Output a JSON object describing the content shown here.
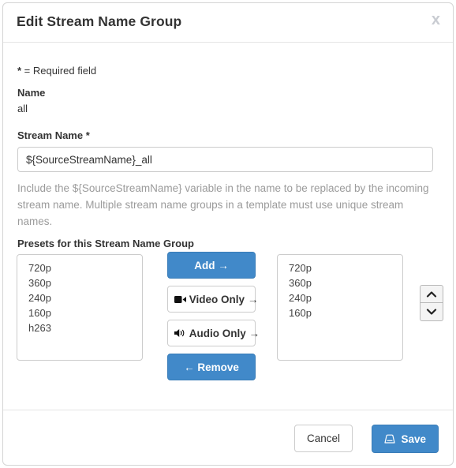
{
  "modal": {
    "title": "Edit Stream Name Group",
    "close_label": "x"
  },
  "form": {
    "required_note_star": "*",
    "required_note_text": " = Required field",
    "name_label": "Name",
    "name_value": "all",
    "stream_name_label": "Stream Name *",
    "stream_name_value": "${SourceStreamName}_all",
    "stream_name_placeholder": "${SourceStreamName}",
    "help_text": "Include the ${SourceStreamName} variable in the name to be replaced by the incoming stream name. Multiple stream name groups in a template must use unique stream names."
  },
  "presets": {
    "section_label": "Presets for this Stream Name Group",
    "available": [
      "720p",
      "360p",
      "240p",
      "160p",
      "h263"
    ],
    "selected": [
      "720p",
      "360p",
      "240p",
      "160p"
    ],
    "buttons": {
      "add": "Add",
      "add_arrow": "→",
      "video_only": "Video Only",
      "video_only_arrow": "→",
      "audio_only": "Audio Only",
      "audio_only_arrow": "→",
      "remove": "Remove",
      "remove_arrow": "←"
    },
    "order": {
      "move_up": "move-up",
      "move_down": "move-down"
    }
  },
  "footer": {
    "cancel_label": "Cancel",
    "save_label": "Save"
  },
  "colors": {
    "primary": "#4189c9",
    "primary_border": "#3a7db8",
    "text": "#333333",
    "muted": "#9b9b9b",
    "border": "#cccccc"
  }
}
